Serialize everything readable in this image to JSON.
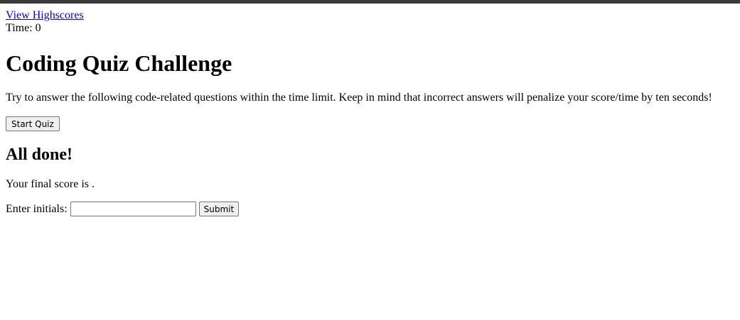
{
  "header": {
    "highscores_link": "View Highscores",
    "timer_label": "Time: ",
    "timer_value": "0"
  },
  "main": {
    "title": "Coding Quiz Challenge",
    "intro": "Try to answer the following code-related questions within the time limit. Keep in mind that incorrect answers will penalize your score/time by ten seconds!",
    "start_button": "Start Quiz"
  },
  "results": {
    "title": "All done!",
    "final_score_text": "Your final score is .",
    "initials_label": "Enter initials:",
    "initials_value": "",
    "initials_placeholder": "",
    "submit_button": "Submit"
  },
  "colors": {
    "link": "#0000ee",
    "top_bar": "#3a3a3a",
    "button_bg": "#efefef",
    "button_border": "#767676"
  }
}
